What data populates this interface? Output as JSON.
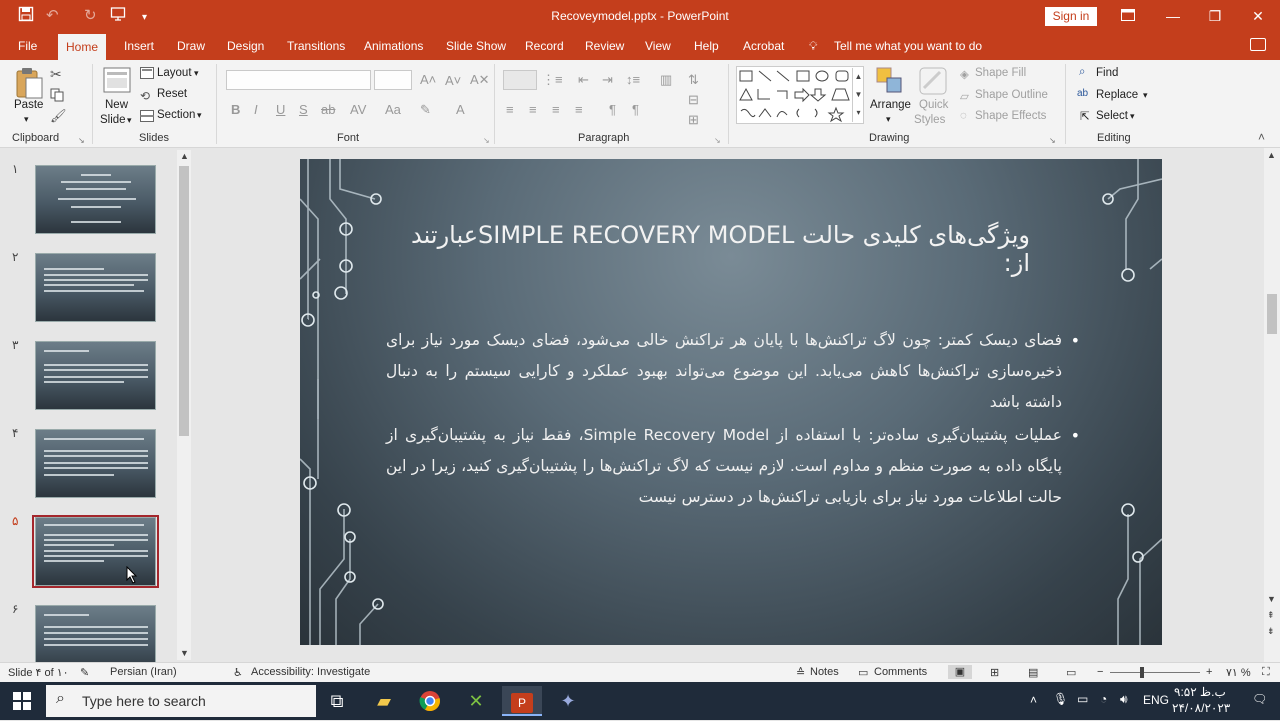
{
  "window": {
    "title": "Recoveymodel.pptx - PowerPoint",
    "sign_in": "Sign in"
  },
  "ribbon_tabs": [
    "File",
    "Home",
    "Insert",
    "Draw",
    "Design",
    "Transitions",
    "Animations",
    "Slide Show",
    "Record",
    "Review",
    "View",
    "Help",
    "Acrobat"
  ],
  "tell_me": "Tell me what you want to do",
  "ribbon": {
    "clipboard": {
      "paste": "Paste",
      "label": "Clipboard"
    },
    "slides": {
      "new_slide_1": "New",
      "new_slide_2": "Slide",
      "layout": "Layout",
      "reset": "Reset",
      "section": "Section",
      "label": "Slides"
    },
    "font": {
      "label": "Font"
    },
    "paragraph": {
      "label": "Paragraph"
    },
    "drawing": {
      "arrange": "Arrange",
      "quick_styles_1": "Quick",
      "quick_styles_2": "Styles",
      "shape_fill": "Shape Fill",
      "shape_outline": "Shape Outline",
      "shape_effects": "Shape Effects",
      "label": "Drawing"
    },
    "editing": {
      "find": "Find",
      "replace": "Replace",
      "select": "Select",
      "label": "Editing"
    }
  },
  "thumbnails": [
    {
      "num": "۱"
    },
    {
      "num": "۲"
    },
    {
      "num": "۳"
    },
    {
      "num": "۴"
    },
    {
      "num": "۵"
    },
    {
      "num": "۶"
    }
  ],
  "selected_slide_index": 4,
  "slide": {
    "title": "ویژگی‌های کلیدی حالت  SIMPLE RECOVERY MODELعبارتند از:",
    "bullets": [
      "فضای دیسک کمتر: چون لاگ تراکنش‌ها با پایان هر تراکنش خالی می‌شود، فضای دیسک مورد نیاز برای ذخیره‌سازی تراکنش‌ها کاهش می‌یابد. این موضوع می‌تواند بهبود عملکرد و کارایی سیستم را به دنبال داشته باشد",
      "عملیات پشتیبان‌گیری ساده‌تر: با استفاده از Simple Recovery Model، فقط نیاز به پشتیبان‌گیری از پایگاه داده به صورت منظم و مداوم است. لازم نیست که لاگ تراکنش‌ها را پشتیبان‌گیری کنید، زیرا در این حالت اطلاعات مورد نیاز برای بازیابی تراکنش‌ها در دسترس نیست"
    ]
  },
  "status_bar": {
    "slide_info": "Slide ۴ of ۱۰",
    "language": "Persian (Iran)",
    "accessibility": "Accessibility: Investigate",
    "notes": "Notes",
    "comments": "Comments",
    "zoom": "۷۱ %"
  },
  "taskbar": {
    "search_placeholder": "Type here to search",
    "lang": "ENG",
    "time": "۹:۵۲ ب.ظ",
    "date": "۲۴/۰۸/۲۰۲۳"
  },
  "colors": {
    "accent": "#c43e1c",
    "selection": "#a4262c"
  }
}
